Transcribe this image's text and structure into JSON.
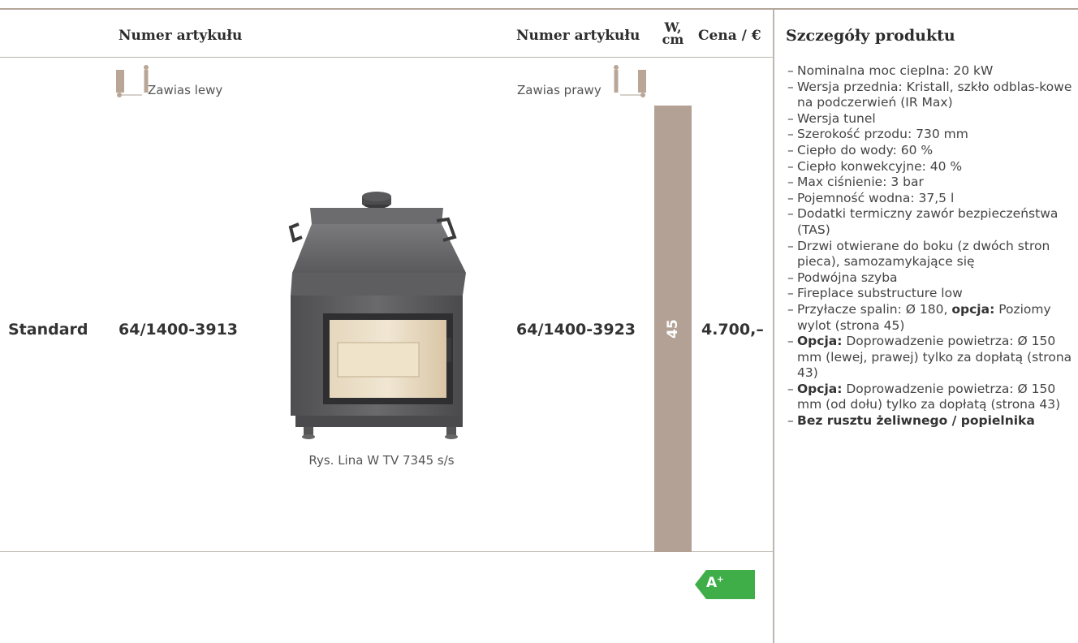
{
  "header": {
    "col_left": "Numer artykułu",
    "col_right": "Numer artykułu",
    "w_top": "W,",
    "w_bottom": "cm",
    "price": "Cena / €",
    "details": "Szczegóły produktu"
  },
  "hinge": {
    "left_label": "Zawias lewy",
    "right_label": "Zawias prawy",
    "left_icon": "hinge-left-icon",
    "right_icon": "hinge-right-icon"
  },
  "row": {
    "label": "Standard",
    "art_left": "64/1400-3913",
    "art_right": "64/1400-3923",
    "width": "45",
    "price": "4.700,–",
    "image_caption": "Rys. Lina W TV 7345 s/s"
  },
  "details": [
    {
      "text": "Nominalna moc cieplna: 20 kW"
    },
    {
      "text": "Wersja przednia: Kristall, szkło odblas-kowe na podczerwień (IR Max)"
    },
    {
      "text": "Wersja tunel"
    },
    {
      "text": "Szerokość przodu: 730 mm"
    },
    {
      "text": "Ciepło do wody: 60 %"
    },
    {
      "text": "Ciepło konwekcyjne: 40 %"
    },
    {
      "text": "Max ciśnienie: 3 bar"
    },
    {
      "text": "Pojemność wodna: 37,5 l"
    },
    {
      "text": "Dodatki termiczny zawór bezpieczeństwa (TAS)"
    },
    {
      "text": "Drzwi otwierane do boku (z dwóch stron pieca), samozamykające się"
    },
    {
      "text": "Podwójna szyba"
    },
    {
      "text": "Fireplace substructure low"
    },
    {
      "pre": "Przyłacze spalin: Ø 180, ",
      "bold": "opcja:",
      "post": " Poziomy wylot (strona 45)"
    },
    {
      "bold": "Opcja:",
      "post": " Doprowadzenie powietrza: Ø 150 mm (lewej, prawej) tylko za dopłatą (strona 43)"
    },
    {
      "bold": "Opcja:",
      "post": " Doprowadzenie powietrza: Ø 150 mm (od dołu) tylko za dopłatą (strona 43)"
    },
    {
      "bold": "Bez rusztu żeliwnego / popielnika"
    }
  ],
  "energy_badge": {
    "label": "A",
    "sup": "+",
    "color": "#3fae49"
  }
}
